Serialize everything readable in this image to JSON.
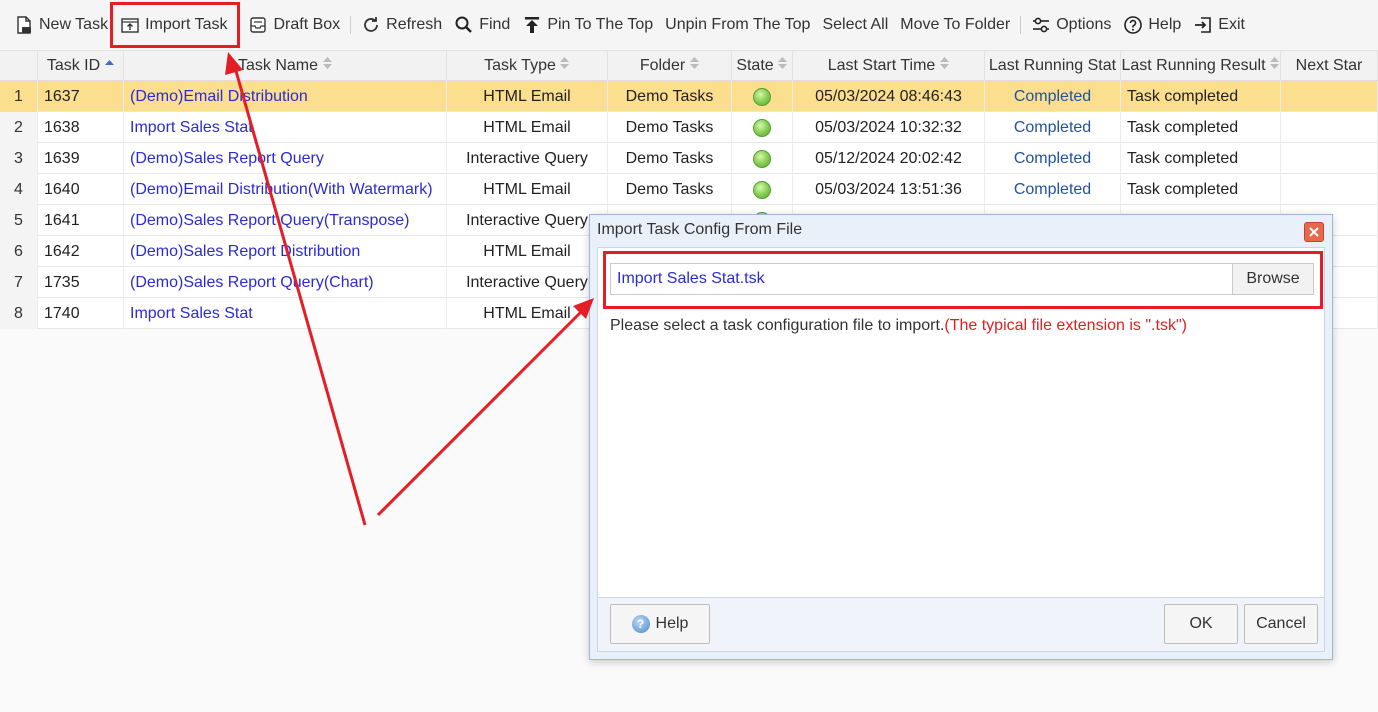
{
  "toolbar": {
    "items": [
      {
        "label": "New Task",
        "icon": "new-task-icon"
      },
      {
        "label": "Import Task",
        "icon": "import-icon"
      },
      {
        "label": "Draft Box",
        "icon": "draft-box-icon"
      },
      {
        "label": "Refresh",
        "icon": "refresh-icon"
      },
      {
        "label": "Find",
        "icon": "search-icon"
      },
      {
        "label": "Pin To The Top",
        "icon": "pin-top-icon"
      },
      {
        "label": "Unpin From The Top"
      },
      {
        "label": "Select All"
      },
      {
        "label": "Move To Folder"
      },
      {
        "label": "Options",
        "icon": "options-icon"
      },
      {
        "label": "Help",
        "icon": "help-icon"
      },
      {
        "label": "Exit",
        "icon": "exit-icon"
      }
    ]
  },
  "grid": {
    "columns": [
      "Task ID",
      "Task Name",
      "Task Type",
      "Folder",
      "State",
      "Last Start Time",
      "Last Running Stat",
      "Last Running Result",
      "Next Star"
    ],
    "rows": [
      {
        "num": "1",
        "id": "1637",
        "name": "(Demo)Email Distribution",
        "type": "HTML Email",
        "folder": "Demo Tasks",
        "start": "05/03/2024 08:46:43",
        "status": "Completed",
        "result": "Task completed",
        "selected": true
      },
      {
        "num": "2",
        "id": "1638",
        "name": "Import Sales Stat",
        "type": "HTML Email",
        "folder": "Demo Tasks",
        "start": "05/03/2024 10:32:32",
        "status": "Completed",
        "result": "Task completed"
      },
      {
        "num": "3",
        "id": "1639",
        "name": "(Demo)Sales Report Query",
        "type": "Interactive Query",
        "folder": "Demo Tasks",
        "start": "05/12/2024 20:02:42",
        "status": "Completed",
        "result": "Task completed"
      },
      {
        "num": "4",
        "id": "1640",
        "name": "(Demo)Email Distribution(With Watermark)",
        "type": "HTML Email",
        "folder": "Demo Tasks",
        "start": "05/03/2024 13:51:36",
        "status": "Completed",
        "result": "Task completed"
      },
      {
        "num": "5",
        "id": "1641",
        "name": "(Demo)Sales Report Query(Transpose)",
        "type": "Interactive Query",
        "folder": "",
        "start": "",
        "status": "",
        "result": ""
      },
      {
        "num": "6",
        "id": "1642",
        "name": "(Demo)Sales Report Distribution",
        "type": "HTML Email",
        "folder": "",
        "start": "",
        "status": "",
        "result": ""
      },
      {
        "num": "7",
        "id": "1735",
        "name": "(Demo)Sales Report Query(Chart)",
        "type": "Interactive Query",
        "folder": "",
        "start": "",
        "status": "",
        "result": ""
      },
      {
        "num": "8",
        "id": "1740",
        "name": "Import Sales Stat",
        "type": "HTML Email",
        "folder": "",
        "start": "",
        "status": "",
        "result": ""
      }
    ]
  },
  "dialog": {
    "title": "Import Task Config From File",
    "file_value": "Import Sales Stat.tsk",
    "browse_label": "Browse",
    "hint": "Please select a task configuration file to import.",
    "hint_red": "(The typical file extension is \".tsk\")",
    "help_label": "Help",
    "ok_label": "OK",
    "cancel_label": "Cancel"
  },
  "colors": {
    "selected_row": "#fbdf8e",
    "link_text": "#2b2bd6",
    "annotation_red": "#e41e26"
  }
}
